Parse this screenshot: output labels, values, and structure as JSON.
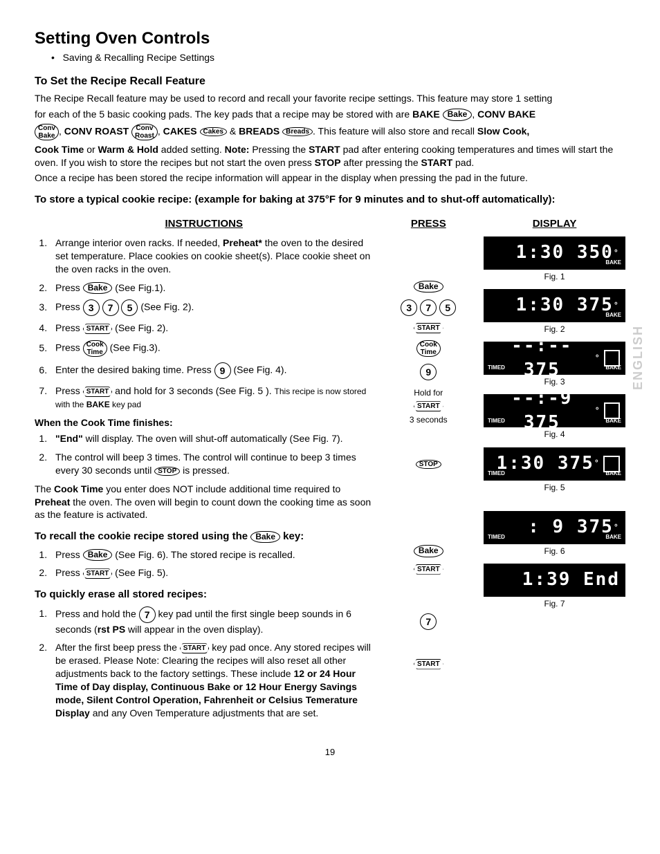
{
  "title": "Setting Oven Controls",
  "subtitle": "Saving & Recalling Recipe Settings",
  "h_recipe_recall": "To Set the Recipe Recall Feature",
  "pads": {
    "bake": "Bake",
    "convbake": "Conv\nBake",
    "convroast": "Conv\nRoast",
    "cakes": "Cakes",
    "breads": "Breads",
    "start": "START",
    "stop": "STOP",
    "cooktime": "Cook\nTime",
    "n3": "3",
    "n5": "5",
    "n7": "7",
    "n9": "9"
  },
  "intro_p1a": "The Recipe Recall feature may be used to record and recall your favorite recipe settings. This feature may store 1 setting",
  "intro_p1b_a": "for each of the 5 basic cooking pads. The key pads that a recipe may be stored with are ",
  "intro_bake": "BAKE",
  "intro_comma": ", ",
  "intro_convbake": "CONV BAKE",
  "intro_convroast": "CONV ROAST",
  "intro_cakes": "CAKES",
  "intro_amp": " & ",
  "intro_breads": "BREADS",
  "intro_p2a": ".  This feature will also store and recall ",
  "intro_slowcook": "Slow Cook,",
  "intro_p3a": "Cook Time",
  "intro_p3b": " or ",
  "intro_p3c": "Warm & Hold",
  "intro_p3d": " added setting. ",
  "intro_p3e": "Note:",
  "intro_p3f": " Pressing the ",
  "intro_p3g": "START",
  "intro_p3h": " pad after entering cooking temperatures and times will start the oven. If you wish to store the recipes but not start the oven press ",
  "intro_p3i": "STOP",
  "intro_p3j": " after pressing the ",
  "intro_p3k": "START",
  "intro_p3l": " pad.",
  "intro_p4": "Once a recipe has been stored  the recipe information will appear in the display when pressing the pad in the future.",
  "h_store": "To store a typical cookie recipe: (example for baking at 375°F for 9 minutes and to shut-off automatically):",
  "col_instr": "INSTRUCTIONS",
  "col_press": "PRESS",
  "col_display": "DISPLAY",
  "step1a": "Arrange interior oven racks. If needed, ",
  "step1b": "Preheat*",
  "step1c": " the oven to the desired set temperature. Place cookies on cookie sheet(s). Place cookie sheet on the oven racks in the oven.",
  "step2a": "Press ",
  "step2b": " (See Fig.1).",
  "step3a": "Press ",
  "step3b": "(See Fig. 2).",
  "step4a": "Press ",
  "step4b": " (See Fig. 2).",
  "step5a": "Press ",
  "step5b": " (See Fig.3).",
  "step6a": "Enter the desired baking time. Press ",
  "step6b": "(See Fig. 4).",
  "step7a": "Press ",
  "step7b": " and hold for 3 seconds (See Fig. 5 ). ",
  "step7c": "This recipe is now stored with the ",
  "step7d": "BAKE",
  "step7e": " key pad",
  "h_finish": "When the Cook Time finishes:",
  "fin1a": "\"End\"",
  "fin1b": " will display. The oven will shut-off automatically (See Fig. 7).",
  "fin2a": "The control will beep 3 times. The control will continue to beep 3 times every 30 seconds until ",
  "fin2b": " is pressed.",
  "note_ct_a": "The ",
  "note_ct_b": "Cook Time",
  "note_ct_c": " you enter does NOT include additional time required to ",
  "note_ct_d": "Preheat",
  "note_ct_e": " the oven. The oven will begin to count down the cooking time as soon as the feature is activated.",
  "h_recall_a": "To recall the cookie recipe stored using the ",
  "h_recall_b": " key:",
  "rec1a": "Press ",
  "rec1b": " (See Fig. 6). The stored recipe is recalled.",
  "rec2a": "Press ",
  "rec2b": "(See Fig. 5).",
  "h_erase": "To quickly erase all stored recipes:",
  "er1a": "Press and hold the ",
  "er1b": " key pad until the first single beep sounds in 6 seconds (",
  "er1c": "rst PS",
  "er1d": " will appear in the oven display).",
  "er2a": "After the first beep press the ",
  "er2b": " key pad once.  Any stored recipes will be erased. Please Note: Clearing the recipes will also reset all other adjustments back to the factory settings. These include ",
  "er2c": "12 or 24 Hour Time of Day display,  Continuous Bake or 12 Hour Energy Savings mode, Silent Control Operation, Fahrenheit or Celsius Temerature Display",
  "er2d": " and any Oven Temperature adjustments that are set.",
  "press_holdfor": "Hold for",
  "press_3sec": "3  seconds",
  "fig": {
    "f1": "Fig. 1",
    "f2": "Fig. 2",
    "f3": "Fig. 3",
    "f4": "Fig. 4",
    "f5": "Fig. 5",
    "f6": "Fig. 6",
    "f7": "Fig. 7"
  },
  "disp": {
    "d1": "1:30 350",
    "d1_br": "BAKE",
    "d2": "1:30 375",
    "d2_br": "BAKE",
    "d3": "--:-- 375",
    "d3_bl": "TIMED",
    "d3_br": "BAKE",
    "d4": "--:-9 375",
    "d4_bl": "TIMED",
    "d4_br": "BAKE",
    "d5": "1:30 375",
    "d5_bl": "TIMED",
    "d5_br": "BAKE",
    "d6": ": 9 375",
    "d6_bl": "TIMED",
    "d6_br": "BAKE",
    "d7": "1:39 End"
  },
  "page": "19",
  "side_lang": "ENGLISH"
}
